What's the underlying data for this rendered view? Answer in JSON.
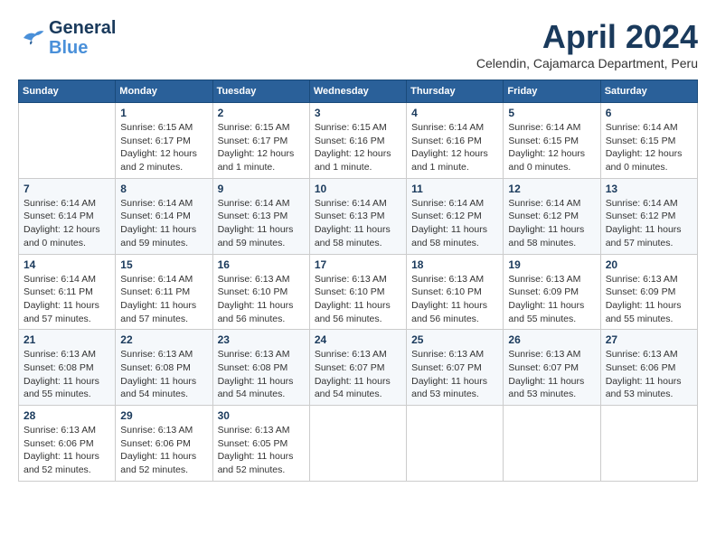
{
  "header": {
    "logo_general": "General",
    "logo_blue": "Blue",
    "month_title": "April 2024",
    "subtitle": "Celendin, Cajamarca Department, Peru"
  },
  "days_of_week": [
    "Sunday",
    "Monday",
    "Tuesday",
    "Wednesday",
    "Thursday",
    "Friday",
    "Saturday"
  ],
  "weeks": [
    [
      {
        "day": "",
        "info": ""
      },
      {
        "day": "1",
        "info": "Sunrise: 6:15 AM\nSunset: 6:17 PM\nDaylight: 12 hours\nand 2 minutes."
      },
      {
        "day": "2",
        "info": "Sunrise: 6:15 AM\nSunset: 6:17 PM\nDaylight: 12 hours\nand 1 minute."
      },
      {
        "day": "3",
        "info": "Sunrise: 6:15 AM\nSunset: 6:16 PM\nDaylight: 12 hours\nand 1 minute."
      },
      {
        "day": "4",
        "info": "Sunrise: 6:14 AM\nSunset: 6:16 PM\nDaylight: 12 hours\nand 1 minute."
      },
      {
        "day": "5",
        "info": "Sunrise: 6:14 AM\nSunset: 6:15 PM\nDaylight: 12 hours\nand 0 minutes."
      },
      {
        "day": "6",
        "info": "Sunrise: 6:14 AM\nSunset: 6:15 PM\nDaylight: 12 hours\nand 0 minutes."
      }
    ],
    [
      {
        "day": "7",
        "info": "Sunrise: 6:14 AM\nSunset: 6:14 PM\nDaylight: 12 hours\nand 0 minutes."
      },
      {
        "day": "8",
        "info": "Sunrise: 6:14 AM\nSunset: 6:14 PM\nDaylight: 11 hours\nand 59 minutes."
      },
      {
        "day": "9",
        "info": "Sunrise: 6:14 AM\nSunset: 6:13 PM\nDaylight: 11 hours\nand 59 minutes."
      },
      {
        "day": "10",
        "info": "Sunrise: 6:14 AM\nSunset: 6:13 PM\nDaylight: 11 hours\nand 58 minutes."
      },
      {
        "day": "11",
        "info": "Sunrise: 6:14 AM\nSunset: 6:12 PM\nDaylight: 11 hours\nand 58 minutes."
      },
      {
        "day": "12",
        "info": "Sunrise: 6:14 AM\nSunset: 6:12 PM\nDaylight: 11 hours\nand 58 minutes."
      },
      {
        "day": "13",
        "info": "Sunrise: 6:14 AM\nSunset: 6:12 PM\nDaylight: 11 hours\nand 57 minutes."
      }
    ],
    [
      {
        "day": "14",
        "info": "Sunrise: 6:14 AM\nSunset: 6:11 PM\nDaylight: 11 hours\nand 57 minutes."
      },
      {
        "day": "15",
        "info": "Sunrise: 6:14 AM\nSunset: 6:11 PM\nDaylight: 11 hours\nand 57 minutes."
      },
      {
        "day": "16",
        "info": "Sunrise: 6:13 AM\nSunset: 6:10 PM\nDaylight: 11 hours\nand 56 minutes."
      },
      {
        "day": "17",
        "info": "Sunrise: 6:13 AM\nSunset: 6:10 PM\nDaylight: 11 hours\nand 56 minutes."
      },
      {
        "day": "18",
        "info": "Sunrise: 6:13 AM\nSunset: 6:10 PM\nDaylight: 11 hours\nand 56 minutes."
      },
      {
        "day": "19",
        "info": "Sunrise: 6:13 AM\nSunset: 6:09 PM\nDaylight: 11 hours\nand 55 minutes."
      },
      {
        "day": "20",
        "info": "Sunrise: 6:13 AM\nSunset: 6:09 PM\nDaylight: 11 hours\nand 55 minutes."
      }
    ],
    [
      {
        "day": "21",
        "info": "Sunrise: 6:13 AM\nSunset: 6:08 PM\nDaylight: 11 hours\nand 55 minutes."
      },
      {
        "day": "22",
        "info": "Sunrise: 6:13 AM\nSunset: 6:08 PM\nDaylight: 11 hours\nand 54 minutes."
      },
      {
        "day": "23",
        "info": "Sunrise: 6:13 AM\nSunset: 6:08 PM\nDaylight: 11 hours\nand 54 minutes."
      },
      {
        "day": "24",
        "info": "Sunrise: 6:13 AM\nSunset: 6:07 PM\nDaylight: 11 hours\nand 54 minutes."
      },
      {
        "day": "25",
        "info": "Sunrise: 6:13 AM\nSunset: 6:07 PM\nDaylight: 11 hours\nand 53 minutes."
      },
      {
        "day": "26",
        "info": "Sunrise: 6:13 AM\nSunset: 6:07 PM\nDaylight: 11 hours\nand 53 minutes."
      },
      {
        "day": "27",
        "info": "Sunrise: 6:13 AM\nSunset: 6:06 PM\nDaylight: 11 hours\nand 53 minutes."
      }
    ],
    [
      {
        "day": "28",
        "info": "Sunrise: 6:13 AM\nSunset: 6:06 PM\nDaylight: 11 hours\nand 52 minutes."
      },
      {
        "day": "29",
        "info": "Sunrise: 6:13 AM\nSunset: 6:06 PM\nDaylight: 11 hours\nand 52 minutes."
      },
      {
        "day": "30",
        "info": "Sunrise: 6:13 AM\nSunset: 6:05 PM\nDaylight: 11 hours\nand 52 minutes."
      },
      {
        "day": "",
        "info": ""
      },
      {
        "day": "",
        "info": ""
      },
      {
        "day": "",
        "info": ""
      },
      {
        "day": "",
        "info": ""
      }
    ]
  ]
}
